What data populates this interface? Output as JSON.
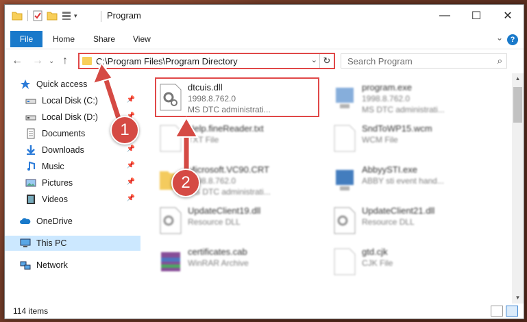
{
  "window": {
    "title": "Program"
  },
  "ribbon": {
    "file": "File",
    "tabs": [
      "Home",
      "Share",
      "View"
    ],
    "help": "?"
  },
  "address": {
    "path": "C:\\Program Files\\Program Directory"
  },
  "search": {
    "placeholder": "Search Program"
  },
  "sidebar": {
    "items": [
      {
        "label": "Quick access",
        "icon": "star-icon"
      },
      {
        "label": "Local Disk (C:)",
        "icon": "drive-icon"
      },
      {
        "label": "Local Disk (D:)",
        "icon": "drive-icon"
      },
      {
        "label": "Documents",
        "icon": "documents-icon"
      },
      {
        "label": "Downloads",
        "icon": "download-icon"
      },
      {
        "label": "Music",
        "icon": "music-icon"
      },
      {
        "label": "Pictures",
        "icon": "pictures-icon"
      },
      {
        "label": "Videos",
        "icon": "videos-icon"
      },
      {
        "label": "OneDrive",
        "icon": "cloud-icon"
      },
      {
        "label": "This PC",
        "icon": "computer-icon"
      },
      {
        "label": "Network",
        "icon": "network-icon"
      }
    ]
  },
  "files": [
    {
      "name": "dtcuis.dll",
      "line2": "1998.8.762.0",
      "line3": "MS DTC administrati...",
      "icon": "dll-icon"
    },
    {
      "name": "program.exe",
      "line2": "1998.8.762.0",
      "line3": "MS DTC administrati...",
      "icon": "exe-icon"
    },
    {
      "name": "Help.fineReader.txt",
      "line2": "TXT File",
      "line3": "",
      "icon": "txt-icon"
    },
    {
      "name": "SndToWP15.wcm",
      "line2": "WCM File",
      "line3": "",
      "icon": "file-icon"
    },
    {
      "name": "Microsoft.VC90.CRT",
      "line2": "1998.8.762.0",
      "line3": "MS DTC administrati...",
      "icon": "folder-icon"
    },
    {
      "name": "AbbyySTI.exe",
      "line2": "ABBY sti event hand...",
      "line3": "",
      "icon": "exe-icon"
    },
    {
      "name": "UpdateClient19.dll",
      "line2": "Resource DLL",
      "line3": "",
      "icon": "dll-icon"
    },
    {
      "name": "UpdateClient21.dll",
      "line2": "Resource DLL",
      "line3": "",
      "icon": "dll-icon"
    },
    {
      "name": "certificates.cab",
      "line2": "WinRAR Archive",
      "line3": "",
      "icon": "archive-icon"
    },
    {
      "name": "gtd.cjk",
      "line2": "CJK File",
      "line3": "",
      "icon": "file-icon"
    }
  ],
  "status": {
    "count": "114 items"
  },
  "callouts": [
    "1",
    "2"
  ],
  "colors": {
    "accent": "#1979ca",
    "highlight": "#e04848",
    "selected": "#cce8ff"
  }
}
